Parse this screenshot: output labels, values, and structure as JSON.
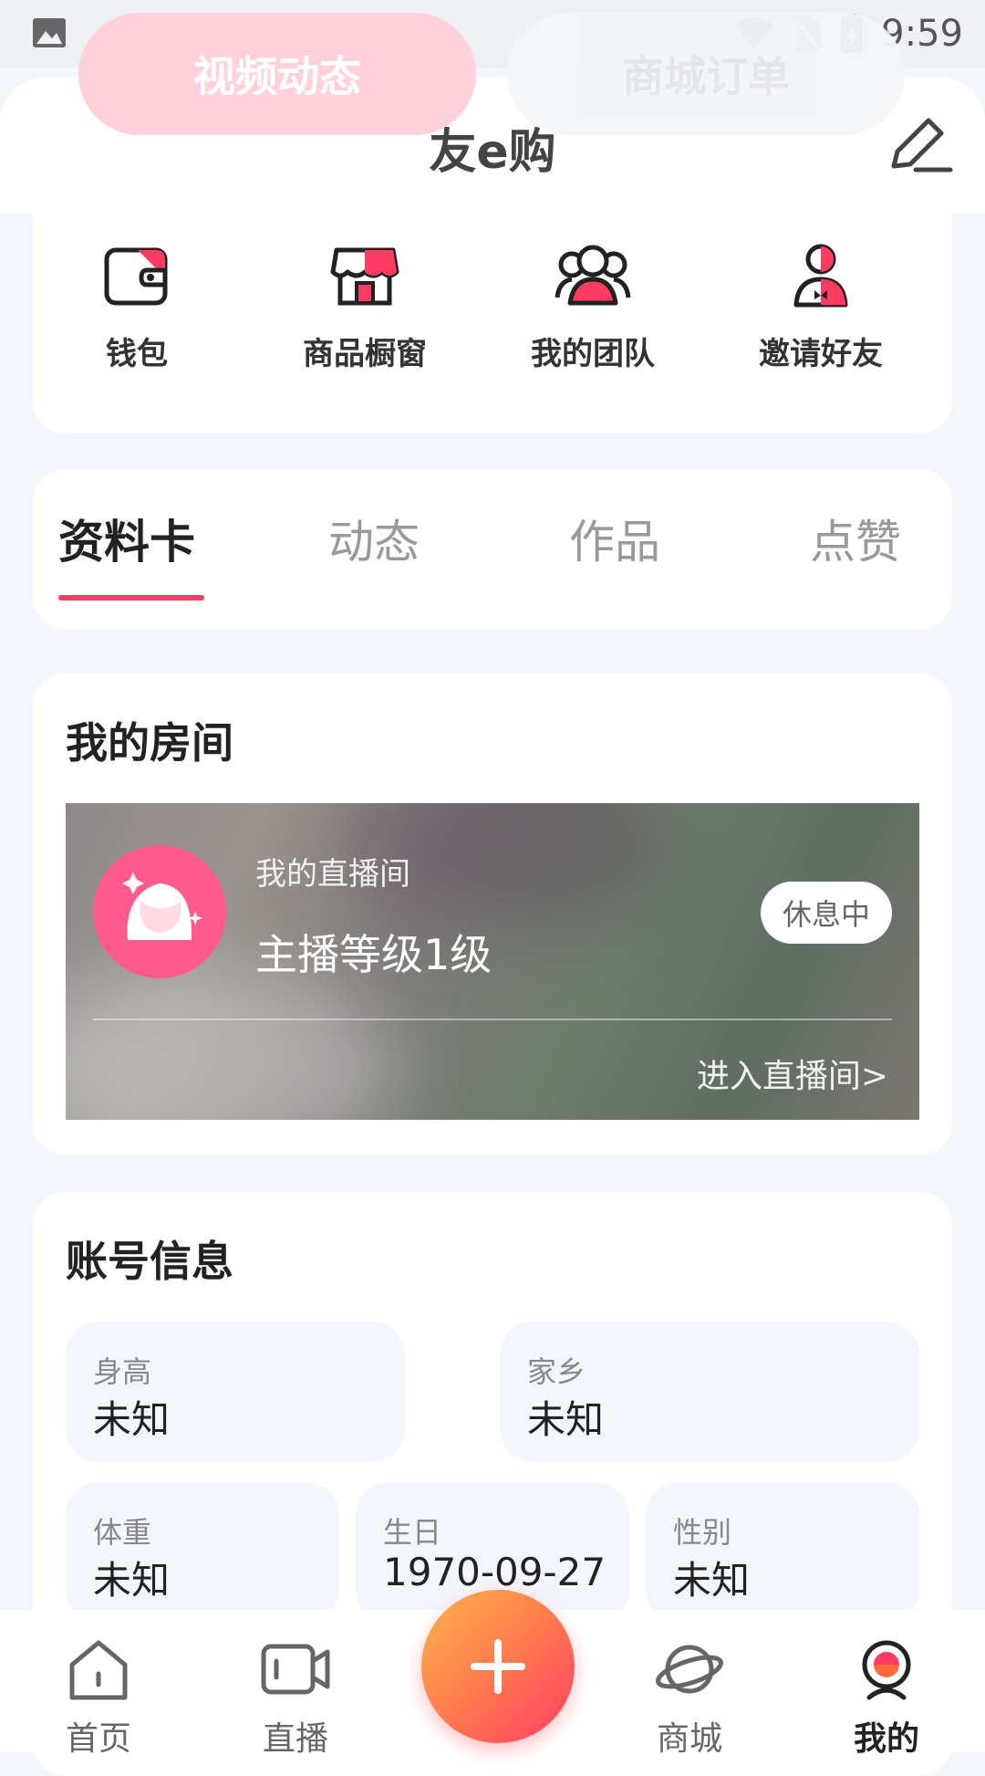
{
  "status_bar": {
    "time": "9:59"
  },
  "header": {
    "title": "友e购",
    "pill_left": "视频动态",
    "pill_right": "商城订单"
  },
  "quick_actions": [
    {
      "label": "钱包",
      "icon": "wallet-icon"
    },
    {
      "label": "商品橱窗",
      "icon": "shop-window-icon"
    },
    {
      "label": "我的团队",
      "icon": "team-icon"
    },
    {
      "label": "邀请好友",
      "icon": "invite-friend-icon"
    }
  ],
  "tabs": [
    {
      "label": "资料卡",
      "active": true
    },
    {
      "label": "动态"
    },
    {
      "label": "作品"
    },
    {
      "label": "点赞"
    }
  ],
  "room": {
    "title": "我的房间",
    "subtitle": "我的直播间",
    "level": "主播等级1级",
    "status": "休息中",
    "enter": "进入直播间>"
  },
  "account": {
    "title": "账号信息",
    "fields": [
      {
        "label": "身高",
        "value": "未知"
      },
      {
        "label": "家乡",
        "value": "未知"
      },
      {
        "label": "体重",
        "value": "未知"
      },
      {
        "label": "生日",
        "value": "1970-09-27"
      },
      {
        "label": "性别",
        "value": "未知"
      }
    ]
  },
  "bottom_nav": [
    {
      "label": "首页",
      "icon": "home-icon"
    },
    {
      "label": "直播",
      "icon": "live-camera-icon"
    },
    {
      "label": "商城",
      "icon": "planet-icon"
    },
    {
      "label": "我的",
      "icon": "profile-icon",
      "active": true
    }
  ],
  "colors": {
    "accent": "#ff3b64",
    "background": "#f3f6fb"
  }
}
